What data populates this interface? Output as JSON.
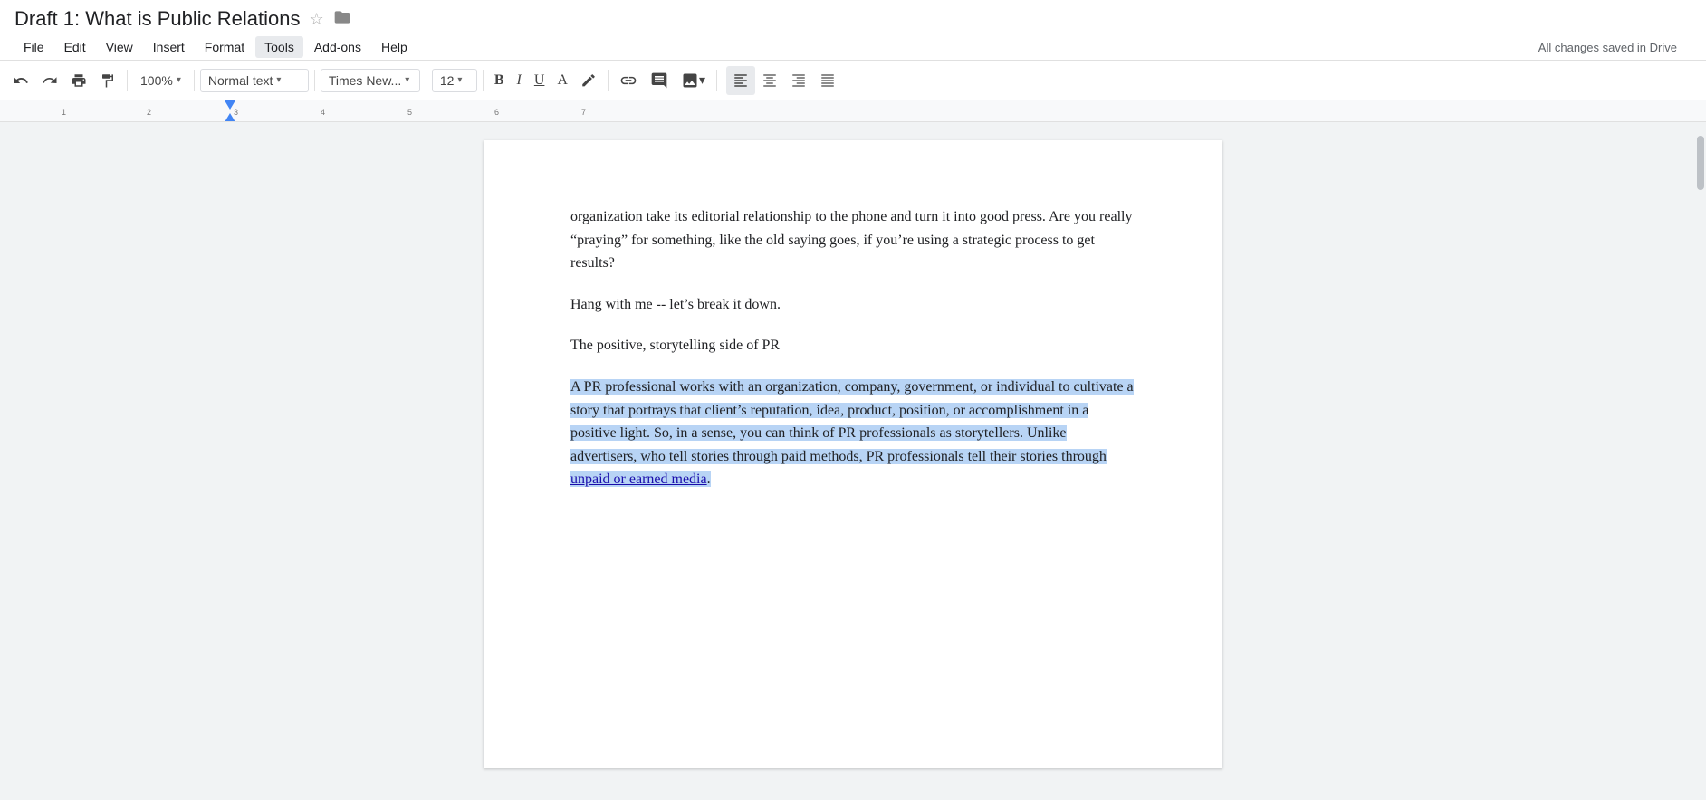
{
  "title_bar": {
    "doc_title": "Draft 1: What is Public Relations",
    "star_icon": "☆",
    "folder_icon": "🗁"
  },
  "menu_bar": {
    "items": [
      "File",
      "Edit",
      "View",
      "Insert",
      "Format",
      "Tools",
      "Add-ons",
      "Help"
    ],
    "active_item": "Tools",
    "saved_status": "All changes saved in Drive"
  },
  "toolbar": {
    "zoom": "100%",
    "style": "Normal text",
    "font": "Times New...",
    "size": "12",
    "bold_label": "B",
    "italic_label": "I",
    "underline_label": "U",
    "font_color_label": "A"
  },
  "ruler": {
    "marks": [
      "1",
      "2",
      "3",
      "4",
      "5",
      "6",
      "7"
    ]
  },
  "document": {
    "paragraphs": [
      {
        "id": "p1",
        "text": "organization take its editorial relationship to the phone and turn it into good press. Are you really “praying” for something, like the old saying goes, if you’re using a strategic process to get results?",
        "highlighted": false,
        "partial_cut": true
      },
      {
        "id": "p2",
        "text": "Hang with me -- let’s break it down.",
        "highlighted": false
      },
      {
        "id": "p3",
        "text": "The positive, storytelling side of PR",
        "highlighted": false
      },
      {
        "id": "p4",
        "text": "A PR professional works with an organization, company, government, or individual to cultivate a story that portrays that client’s reputation, idea, product, position, or accomplishment in a positive light. So, in a sense, you can think of PR professionals as storytellers. Unlike advertisers, who tell stories through paid methods, PR professionals tell their stories through ",
        "highlighted": true,
        "has_link": true,
        "link_text": "unpaid or earned media",
        "after_link": "."
      }
    ]
  }
}
